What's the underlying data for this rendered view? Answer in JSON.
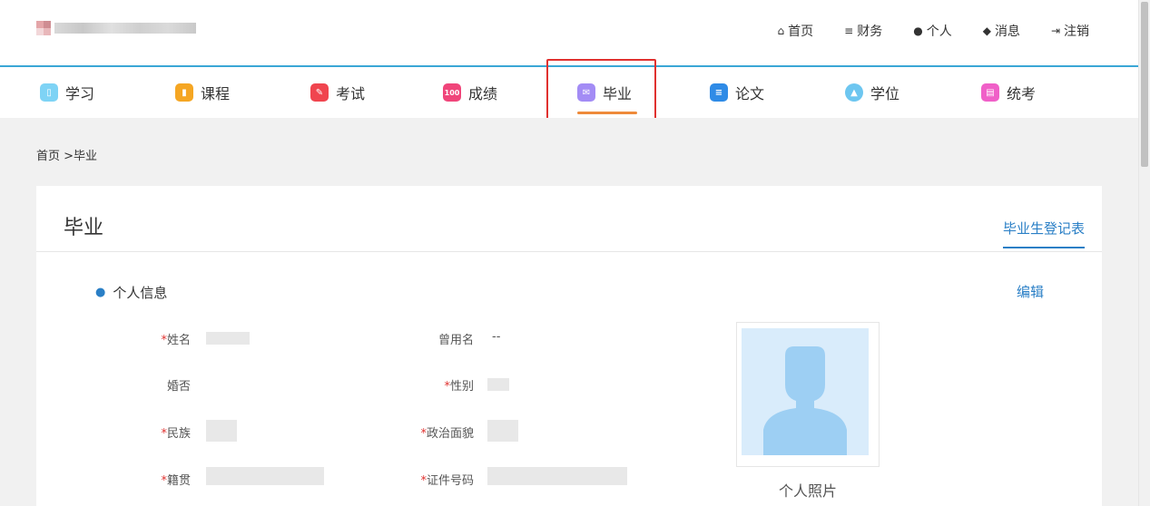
{
  "header": {
    "links": [
      {
        "icon": "home-icon",
        "glyph": "⌂",
        "label": "首页"
      },
      {
        "icon": "database-icon",
        "glyph": "≡",
        "label": "财务"
      },
      {
        "icon": "user-icon",
        "glyph": "●",
        "label": "个人"
      },
      {
        "icon": "bell-icon",
        "glyph": "◆",
        "label": "消息"
      },
      {
        "icon": "logout-icon",
        "glyph": "⇥",
        "label": "注销"
      }
    ]
  },
  "modules": [
    {
      "label": "学习",
      "icon": "study-icon",
      "color": "#7ed3f5"
    },
    {
      "label": "课程",
      "icon": "course-icon",
      "color": "#f5a623"
    },
    {
      "label": "考试",
      "icon": "exam-icon",
      "color": "#f0454f"
    },
    {
      "label": "成绩",
      "icon": "score-icon",
      "color": "#f0457a",
      "glyph": "100"
    },
    {
      "label": "毕业",
      "icon": "graduation-icon",
      "color": "#a38cf5"
    },
    {
      "label": "论文",
      "icon": "thesis-icon",
      "color": "#2f8be6"
    },
    {
      "label": "学位",
      "icon": "degree-icon",
      "color": "#6dc6f0"
    },
    {
      "label": "统考",
      "icon": "unified-exam-icon",
      "color": "#f060c8"
    }
  ],
  "active_module": "毕业",
  "breadcrumb": "首页 >毕业",
  "page": {
    "title": "毕业",
    "tab_label": "毕业生登记表",
    "section_title": "个人信息",
    "edit_label": "编辑",
    "photo_caption": "个人照片"
  },
  "fields": {
    "name": {
      "label": "姓名",
      "required": true
    },
    "former_name": {
      "label": "曾用名",
      "required": false,
      "value": "--"
    },
    "marital": {
      "label": "婚否",
      "required": false
    },
    "gender": {
      "label": "性别",
      "required": true
    },
    "ethnicity": {
      "label": "民族",
      "required": true
    },
    "political": {
      "label": "政治面貌",
      "required": true
    },
    "native_place": {
      "label": "籍贯",
      "required": true
    },
    "id_number": {
      "label": "证件号码",
      "required": true
    }
  },
  "colors": {
    "accent": "#2a7fc6",
    "header_line": "#3aa7d6",
    "active_underline": "#ee8a3a",
    "highlight_box": "#e0312f",
    "required": "#e0312f"
  }
}
